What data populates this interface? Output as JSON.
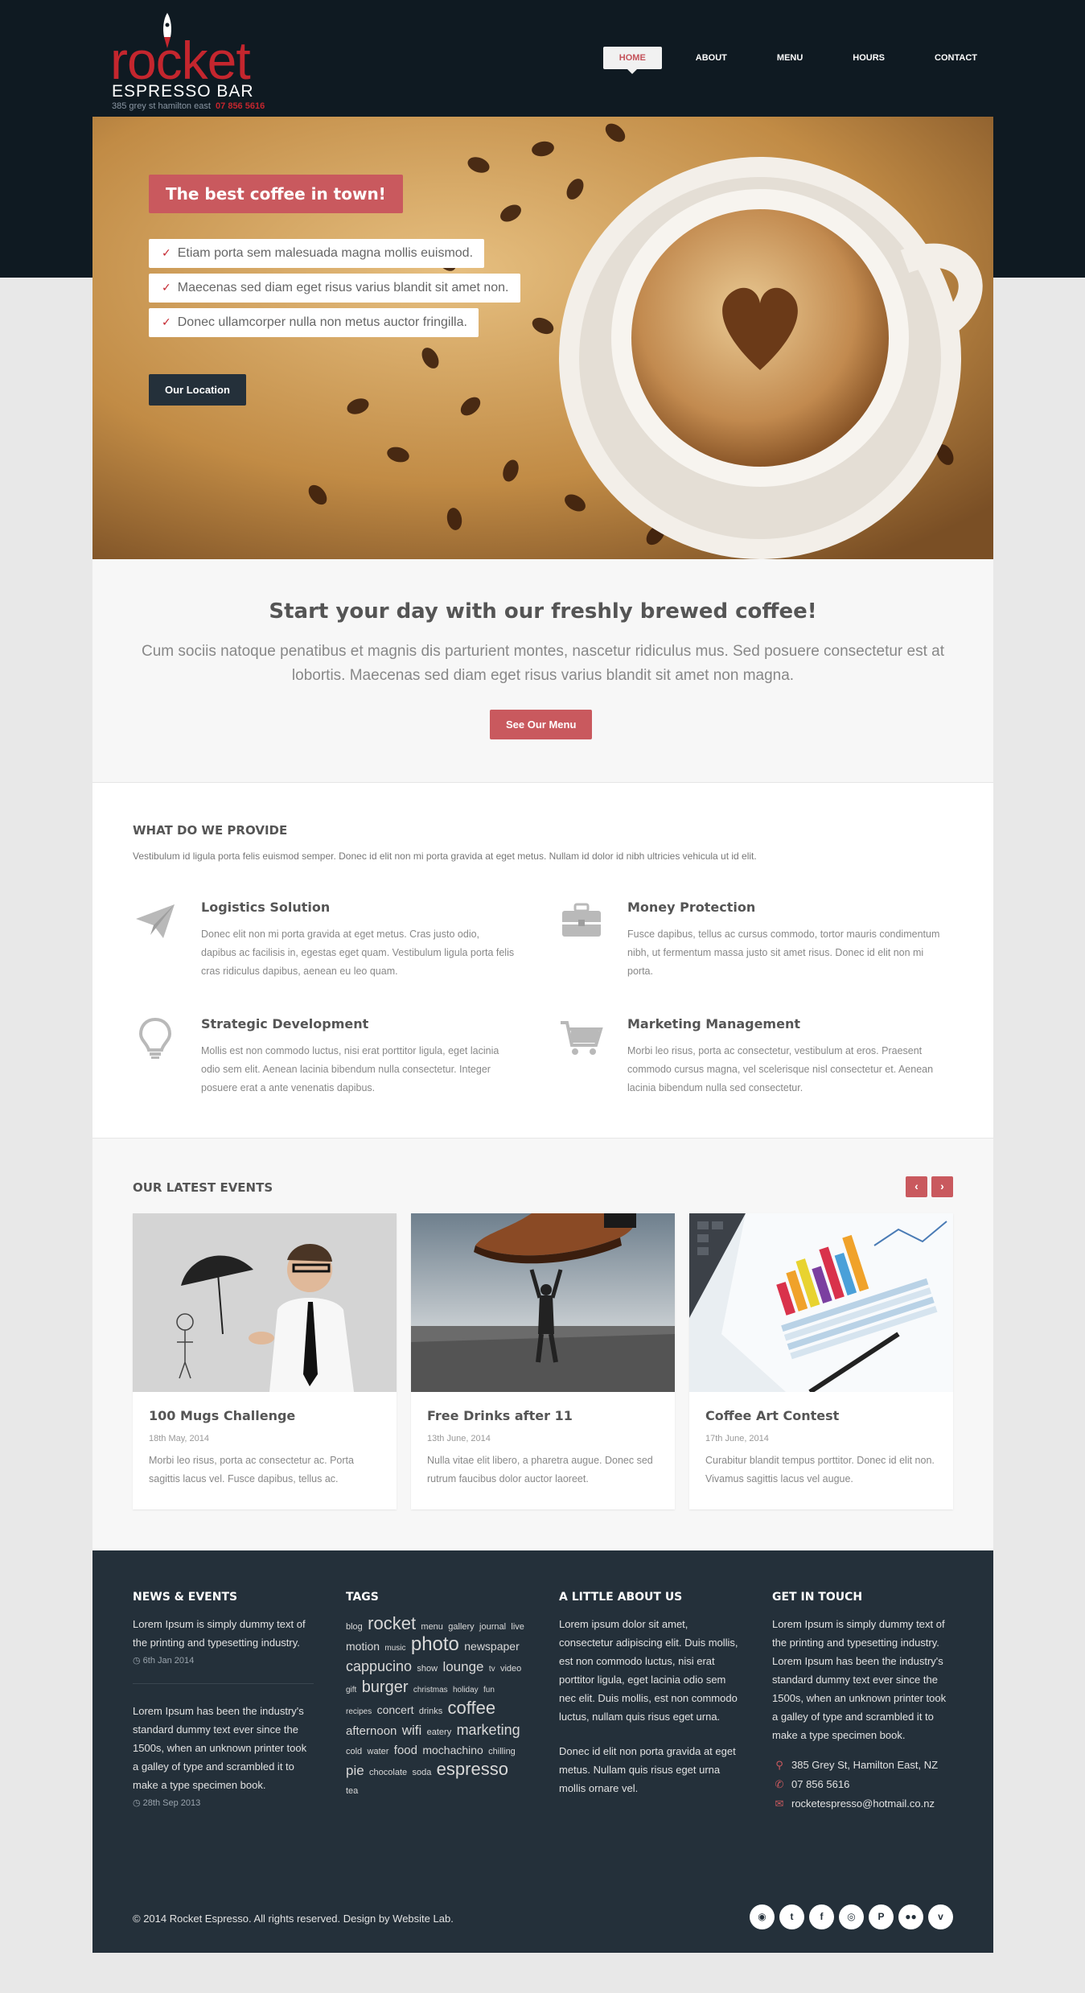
{
  "brand": {
    "name": "rocket",
    "subtitle": "ESPRESSO BAR",
    "address": "385 grey st hamilton east",
    "phone": "07 856 5616"
  },
  "nav": [
    "HOME",
    "ABOUT",
    "MENU",
    "HOURS",
    "CONTACT"
  ],
  "hero": {
    "title": "The best coffee in town!",
    "items": [
      "Etiam porta sem malesuada magna mollis euismod.",
      "Maecenas sed diam eget risus varius blandit sit amet non.",
      "Donec ullamcorper nulla non metus auctor fringilla."
    ],
    "button": "Our Location"
  },
  "intro": {
    "title": "Start your day with our freshly brewed coffee!",
    "text": "Cum sociis natoque penatibus et magnis dis parturient montes, nascetur ridiculus mus. Sed posuere consectetur est at lobortis. Maecenas sed diam eget risus varius blandit sit amet non magna.",
    "button": "See Our Menu"
  },
  "services": {
    "title": "WHAT DO WE PROVIDE",
    "description": "Vestibulum id ligula porta felis euismod semper. Donec id elit non mi porta gravida at eget metus. Nullam id dolor id nibh ultricies vehicula ut id elit.",
    "items": [
      {
        "icon": "paper-plane-icon",
        "title": "Logistics Solution",
        "text": "Donec elit non mi porta gravida at eget metus. Cras justo odio, dapibus ac facilisis in, egestas eget quam. Vestibulum ligula porta felis cras ridiculus dapibus, aenean eu leo quam."
      },
      {
        "icon": "briefcase-icon",
        "title": "Money Protection",
        "text": "Fusce dapibus, tellus ac cursus commodo, tortor mauris condimentum nibh, ut fermentum massa justo sit amet risus. Donec id elit non mi porta."
      },
      {
        "icon": "lightbulb-icon",
        "title": "Strategic Development",
        "text": "Mollis est non commodo luctus, nisi erat porttitor ligula, eget lacinia odio sem elit. Aenean lacinia bibendum nulla consectetur. Integer posuere erat a ante venenatis dapibus."
      },
      {
        "icon": "cart-icon",
        "title": "Marketing Management",
        "text": "Morbi leo risus, porta ac consectetur, vestibulum at eros. Praesent commodo cursus magna, vel scelerisque nisl consectetur et. Aenean lacinia bibendum nulla sed consectetur."
      }
    ]
  },
  "events": {
    "title": "OUR LATEST EVENTS",
    "prev": "‹",
    "next": "›",
    "items": [
      {
        "title": "100 Mugs Challenge",
        "date": "18th May, 2014",
        "text": "Morbi leo risus, porta ac consectetur ac. Porta sagittis lacus vel. Fusce dapibus, tellus ac."
      },
      {
        "title": "Free Drinks after 11",
        "date": "13th June, 2014",
        "text": "Nulla vitae elit libero, a pharetra augue. Donec sed rutrum faucibus dolor auctor laoreet."
      },
      {
        "title": "Coffee Art Contest",
        "date": "17th June, 2014",
        "text": "Curabitur blandit tempus porttitor. Donec id elit non. Vivamus sagittis lacus vel augue."
      }
    ]
  },
  "footer": {
    "news": {
      "title": "NEWS & EVENTS",
      "items": [
        {
          "text": "Lorem Ipsum is simply dummy text of the printing and typesetting industry.",
          "date": "6th Jan 2014"
        },
        {
          "text": "Lorem Ipsum has been the industry's standard dummy text ever since the 1500s, when an unknown printer took a galley of type and scrambled it to make a type specimen book.",
          "date": "28th Sep 2013"
        }
      ]
    },
    "tags": {
      "title": "TAGS",
      "list": [
        {
          "t": "blog",
          "s": 11
        },
        {
          "t": "rocket",
          "s": 22
        },
        {
          "t": "menu",
          "s": 11
        },
        {
          "t": "gallery",
          "s": 11
        },
        {
          "t": "journal",
          "s": 11
        },
        {
          "t": "live",
          "s": 11
        },
        {
          "t": "motion",
          "s": 14
        },
        {
          "t": "music",
          "s": 10
        },
        {
          "t": "photo",
          "s": 24
        },
        {
          "t": "newspaper",
          "s": 14
        },
        {
          "t": "cappucino",
          "s": 18
        },
        {
          "t": "show",
          "s": 11
        },
        {
          "t": "lounge",
          "s": 17
        },
        {
          "t": "tv",
          "s": 10
        },
        {
          "t": "video",
          "s": 11
        },
        {
          "t": "gift",
          "s": 10
        },
        {
          "t": "burger",
          "s": 20
        },
        {
          "t": "christmas",
          "s": 10
        },
        {
          "t": "holiday",
          "s": 10
        },
        {
          "t": "fun",
          "s": 10
        },
        {
          "t": "recipes",
          "s": 10
        },
        {
          "t": "concert",
          "s": 14
        },
        {
          "t": "drinks",
          "s": 11
        },
        {
          "t": "coffee",
          "s": 22
        },
        {
          "t": "afternoon",
          "s": 15
        },
        {
          "t": "wifi",
          "s": 17
        },
        {
          "t": "eatery",
          "s": 11
        },
        {
          "t": "marketing",
          "s": 18
        },
        {
          "t": "cold",
          "s": 11
        },
        {
          "t": "water",
          "s": 11
        },
        {
          "t": "food",
          "s": 15
        },
        {
          "t": "mochachino",
          "s": 14
        },
        {
          "t": "chilling",
          "s": 11
        },
        {
          "t": "pie",
          "s": 17
        },
        {
          "t": "chocolate",
          "s": 11
        },
        {
          "t": "soda",
          "s": 11
        },
        {
          "t": "espresso",
          "s": 22
        },
        {
          "t": "tea",
          "s": 11
        }
      ]
    },
    "about": {
      "title": "A LITTLE ABOUT US",
      "p1": "Lorem ipsum dolor sit amet, consectetur adipiscing elit. Duis mollis, est non commodo luctus, nisi erat porttitor ligula, eget lacinia odio sem nec elit. Duis mollis, est non commodo luctus, nullam quis risus eget urna.",
      "p2": "Donec id elit non porta gravida at eget metus. Nullam quis risus eget urna mollis ornare vel."
    },
    "contact": {
      "title": "GET IN TOUCH",
      "text": "Lorem Ipsum is simply dummy text of the printing and typesetting industry. Lorem Ipsum has been the industry's standard dummy text ever since the 1500s, when an unknown printer took a galley of type and scrambled it to make a type specimen book.",
      "address": "385 Grey St, Hamilton East, NZ",
      "phone": "07 856 5616",
      "email": "rocketespresso@hotmail.co.nz"
    },
    "copyright": "© 2014 Rocket Espresso. All rights reserved. Design by Website Lab.",
    "socials": [
      "rss-icon",
      "twitter-icon",
      "facebook-icon",
      "dribbble-icon",
      "pinterest-icon",
      "flickr-icon",
      "vimeo-icon"
    ]
  },
  "colors": {
    "accent": "#c9595e",
    "dark": "#0f1a22",
    "footer": "#24303a",
    "brand_red": "#c4262e"
  }
}
